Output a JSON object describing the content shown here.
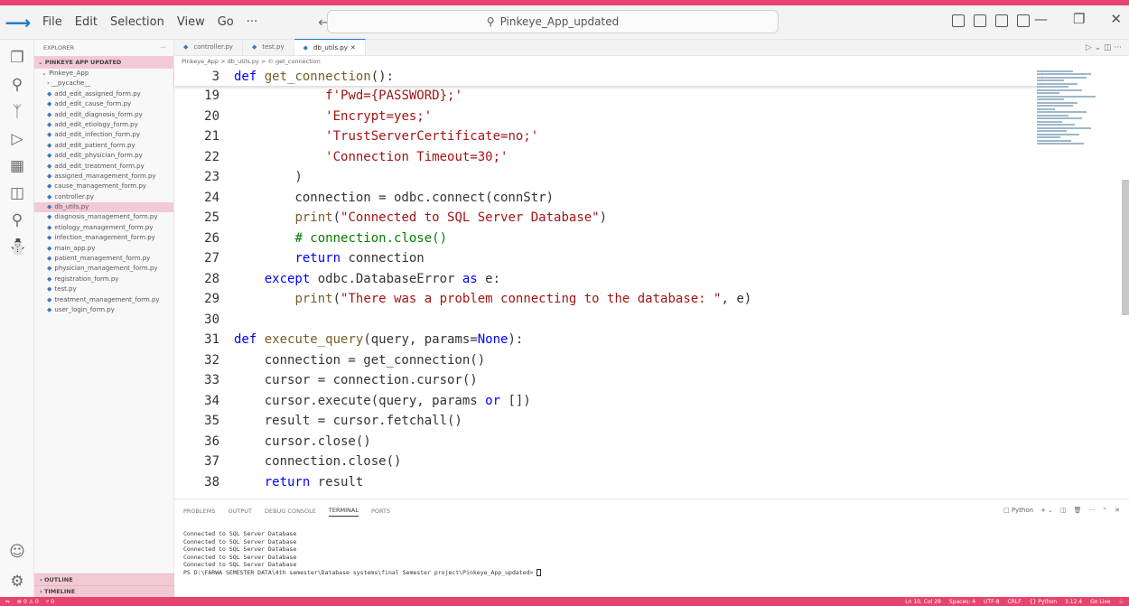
{
  "titlebar": {
    "menu": [
      "File",
      "Edit",
      "Selection",
      "View",
      "Go",
      "···"
    ],
    "search_text": "Pinkeye_App_updated"
  },
  "sidebar": {
    "title": "EXPLORER",
    "root": "PINKEYE APP UPDATED",
    "folder": "Pinkeye_App",
    "subfolder": "__pycache__",
    "files": [
      "add_edit_assigned_form.py",
      "add_edit_cause_form.py",
      "add_edit_diagnosis_form.py",
      "add_edit_etiology_form.py",
      "add_edit_infection_form.py",
      "add_edit_patient_form.py",
      "add_edit_physician_form.py",
      "add_edit_treatment_form.py",
      "assigned_management_form.py",
      "cause_management_form.py",
      "controller.py",
      "db_utils.py",
      "diagnosis_management_form.py",
      "etiology_management_form.py",
      "infection_management_form.py",
      "main_app.py",
      "patient_management_form.py",
      "physician_management_form.py",
      "registration_form.py",
      "test.py",
      "treatment_management_form.py",
      "user_login_form.py"
    ],
    "selected_index": 11,
    "outline": "OUTLINE",
    "timeline": "TIMELINE"
  },
  "tabs": [
    {
      "label": "controller.py",
      "active": false
    },
    {
      "label": "test.py",
      "active": false
    },
    {
      "label": "db_utils.py",
      "active": true
    }
  ],
  "breadcrumb": "Pinkeye_App > db_utils.py > © get_connection",
  "panel": {
    "tabs": [
      "PROBLEMS",
      "OUTPUT",
      "DEBUG CONSOLE",
      "TERMINAL",
      "PORTS"
    ],
    "active_tab": "TERMINAL",
    "shell_label": "Python",
    "terminal_lines": [
      "Connected to SQL Server Database",
      "Connected to SQL Server Database",
      "Connected to SQL Server Database",
      "Connected to SQL Server Database",
      "Connected to SQL Server Database"
    ],
    "prompt": "PS D:\\FARWA SEMESTER DATA\\4th semester\\Database systems\\final Semester project\\Pinkeye_App_updated>"
  },
  "statusbar": {
    "left": [
      "⊗ 0 ⚠ 0",
      "⑂ 0"
    ],
    "right": [
      "Ln 10, Col 29",
      "Spaces: 4",
      "UTF-8",
      "CRLF",
      "{} Python",
      "3.12.4",
      "Go Live"
    ]
  },
  "colors": {
    "accent": "#e8436f",
    "selection": "#f2cad6"
  }
}
